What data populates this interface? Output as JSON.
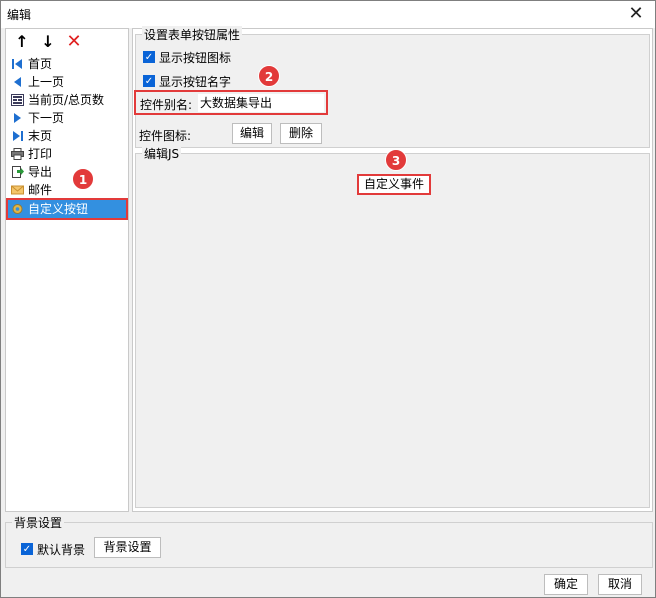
{
  "window": {
    "title": "编辑",
    "close_glyph": "✕"
  },
  "toolbar": {
    "move_up_icon": "↑",
    "move_down_icon": "↓",
    "delete_icon": "✕"
  },
  "button_list": [
    {
      "label": "首页",
      "icon": "first-page-icon"
    },
    {
      "label": "上一页",
      "icon": "prev-page-icon"
    },
    {
      "label": "当前页/总页数",
      "icon": "page-count-icon"
    },
    {
      "label": "下一页",
      "icon": "next-page-icon"
    },
    {
      "label": "末页",
      "icon": "last-page-icon"
    },
    {
      "label": "打印",
      "icon": "print-icon"
    },
    {
      "label": "导出",
      "icon": "export-icon"
    },
    {
      "label": "邮件",
      "icon": "mail-icon"
    },
    {
      "label": "自定义按钮",
      "icon": "gear-icon",
      "selected": true
    }
  ],
  "props": {
    "legend": "设置表单按钮属性",
    "show_icon_label": "显示按钮图标",
    "show_name_label": "显示按钮名字",
    "alias_label": "控件别名:",
    "alias_value": "大数据集导出",
    "icon_label": "控件图标:",
    "edit_button": "编辑",
    "delete_button": "删除"
  },
  "js": {
    "legend": "编辑JS",
    "custom_event_button": "自定义事件"
  },
  "background": {
    "legend": "背景设置",
    "default_bg_label": "默认背景",
    "bg_settings_button": "背景设置"
  },
  "footer": {
    "ok": "确定",
    "cancel": "取消"
  },
  "annotations": [
    "1",
    "2",
    "3"
  ],
  "colors": {
    "accent": "#e23a3a",
    "selection": "#3390e0",
    "checkbox": "#0a64d7"
  }
}
